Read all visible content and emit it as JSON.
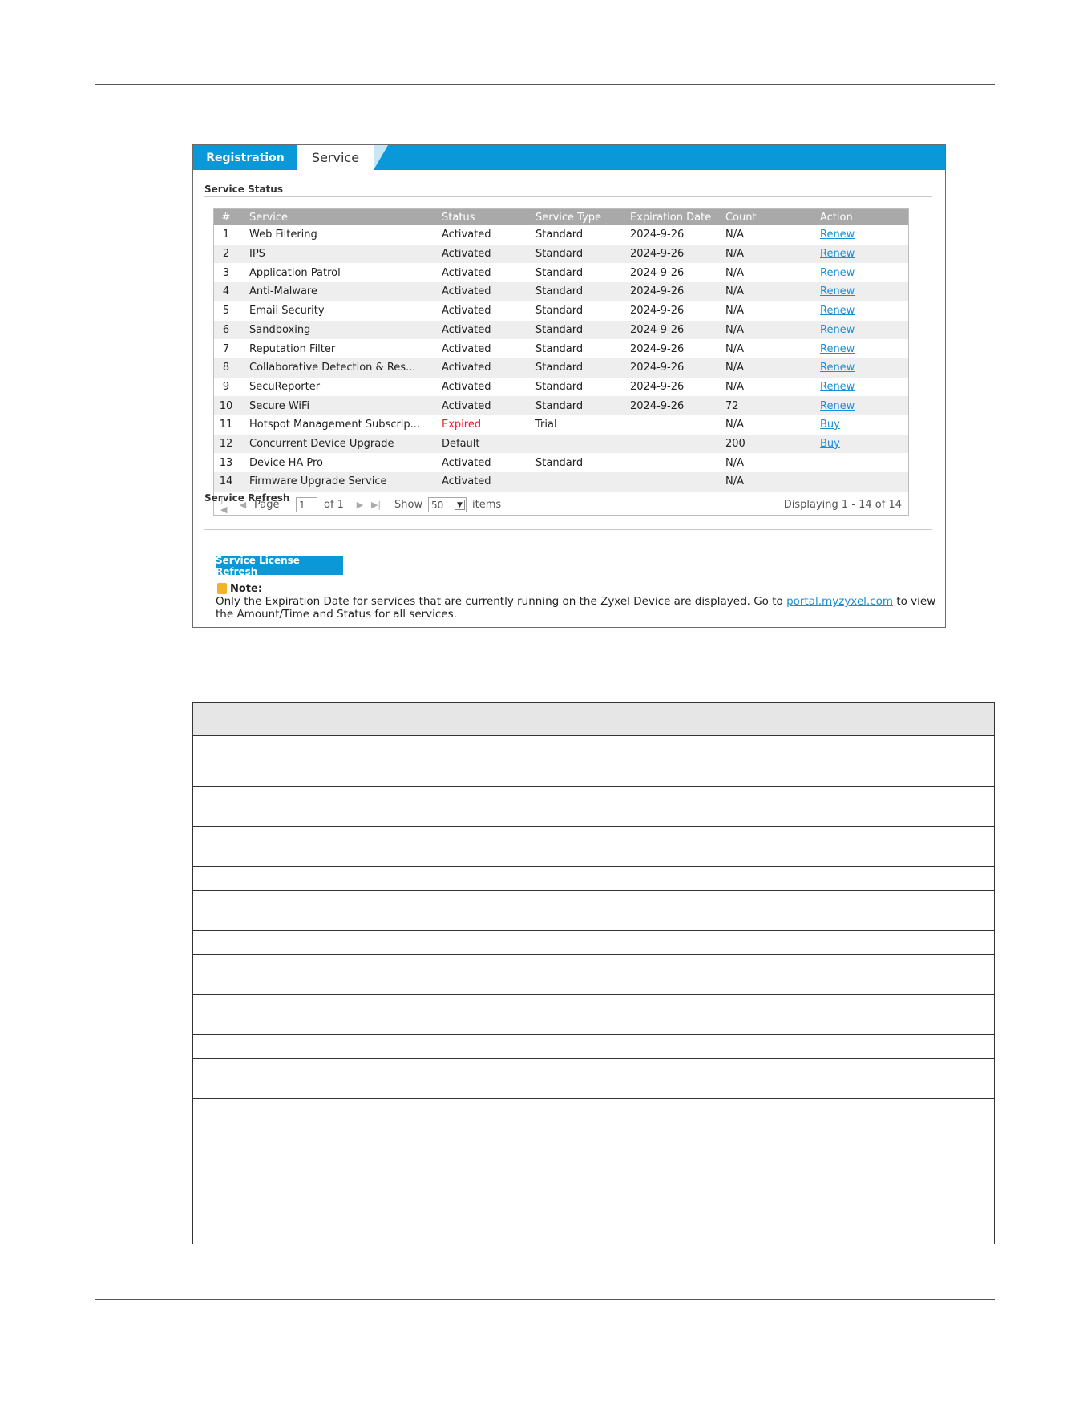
{
  "tabs": [
    {
      "label": "Registration",
      "active": false
    },
    {
      "label": "Service",
      "active": true
    }
  ],
  "service_status": {
    "title": "Service Status",
    "columns": [
      "#",
      "Service",
      "Status",
      "Service Type",
      "Expiration Date",
      "Count",
      "Action"
    ],
    "rows": [
      {
        "num": "1",
        "service": "Web Filtering",
        "status": "Activated",
        "type": "Standard",
        "expiration": "2024-9-26",
        "count": "N/A",
        "action": "Renew"
      },
      {
        "num": "2",
        "service": "IPS",
        "status": "Activated",
        "type": "Standard",
        "expiration": "2024-9-26",
        "count": "N/A",
        "action": "Renew"
      },
      {
        "num": "3",
        "service": "Application Patrol",
        "status": "Activated",
        "type": "Standard",
        "expiration": "2024-9-26",
        "count": "N/A",
        "action": "Renew"
      },
      {
        "num": "4",
        "service": "Anti-Malware",
        "status": "Activated",
        "type": "Standard",
        "expiration": "2024-9-26",
        "count": "N/A",
        "action": "Renew"
      },
      {
        "num": "5",
        "service": "Email Security",
        "status": "Activated",
        "type": "Standard",
        "expiration": "2024-9-26",
        "count": "N/A",
        "action": "Renew"
      },
      {
        "num": "6",
        "service": "Sandboxing",
        "status": "Activated",
        "type": "Standard",
        "expiration": "2024-9-26",
        "count": "N/A",
        "action": "Renew"
      },
      {
        "num": "7",
        "service": "Reputation Filter",
        "status": "Activated",
        "type": "Standard",
        "expiration": "2024-9-26",
        "count": "N/A",
        "action": "Renew"
      },
      {
        "num": "8",
        "service": "Collaborative Detection & Res...",
        "status": "Activated",
        "type": "Standard",
        "expiration": "2024-9-26",
        "count": "N/A",
        "action": "Renew"
      },
      {
        "num": "9",
        "service": "SecuReporter",
        "status": "Activated",
        "type": "Standard",
        "expiration": "2024-9-26",
        "count": "N/A",
        "action": "Renew"
      },
      {
        "num": "10",
        "service": "Secure WiFi",
        "status": "Activated",
        "type": "Standard",
        "expiration": "2024-9-26",
        "count": "72",
        "action": "Renew"
      },
      {
        "num": "11",
        "service": "Hotspot Management Subscrip...",
        "status": "Expired",
        "type": "Trial",
        "expiration": "",
        "count": "N/A",
        "action": "Buy"
      },
      {
        "num": "12",
        "service": "Concurrent Device Upgrade",
        "status": "Default",
        "type": "",
        "expiration": "",
        "count": "200",
        "action": "Buy"
      },
      {
        "num": "13",
        "service": "Device HA Pro",
        "status": "Activated",
        "type": "Standard",
        "expiration": "",
        "count": "N/A",
        "action": ""
      },
      {
        "num": "14",
        "service": "Firmware Upgrade Service",
        "status": "Activated",
        "type": "",
        "expiration": "",
        "count": "N/A",
        "action": ""
      }
    ],
    "pager": {
      "page_label": "Page",
      "page_value": "1",
      "of_label": "of 1",
      "show_label": "Show",
      "page_size": "50",
      "items_label": "items",
      "displaying": "Displaying 1 - 14 of 14"
    }
  },
  "service_refresh": {
    "title": "Service Refresh",
    "button_label": "Service License Refresh"
  },
  "note": {
    "label": "Note:",
    "text_before": "Only the Expiration Date for services that are currently running on the Zyxel Device are displayed. Go to ",
    "link": "portal.myzyxel.com",
    "text_after": " to view the Amount/Time and Status for all services."
  },
  "colors": {
    "tab_bar": "#0b98d8",
    "header_row": "#a9a9a9",
    "link": "#1a8fd6",
    "expired": "#e8202a"
  }
}
